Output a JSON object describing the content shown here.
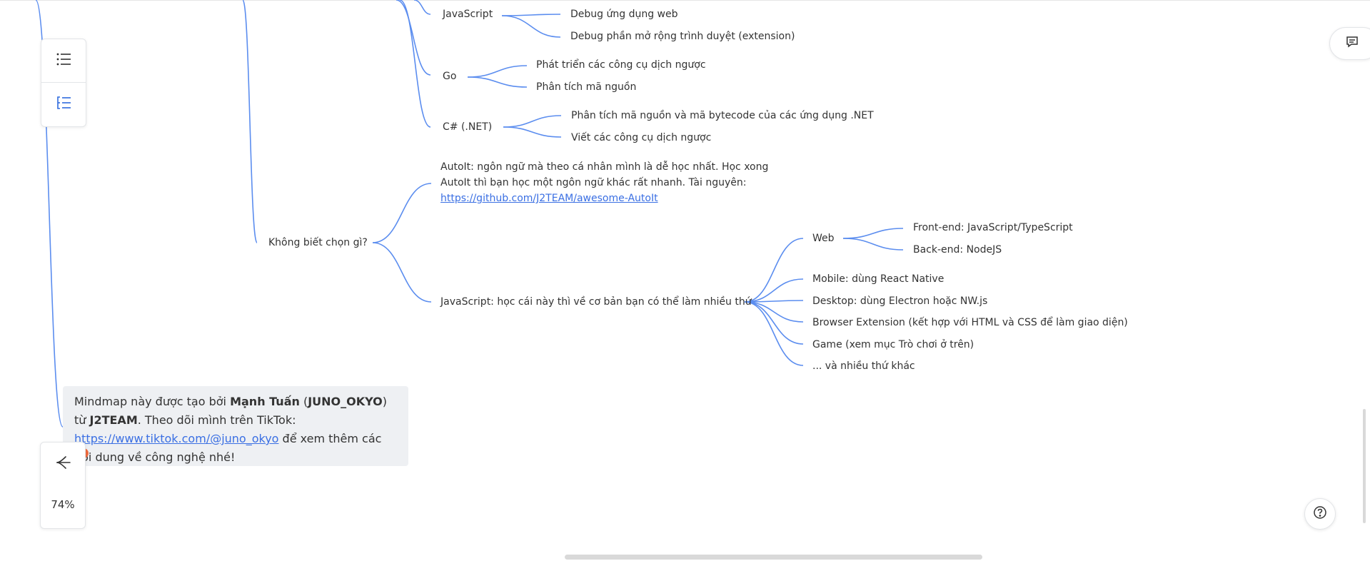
{
  "mindmap": {
    "lang_js": "JavaScript",
    "js_1": "Debug ứng dụng web",
    "js_2": "Debug phần mở rộng trình duyệt (extension)",
    "lang_go": "Go",
    "go_1": "Phát triển các công cụ dịch ngược",
    "go_2": "Phân tích mã nguồn",
    "lang_cs": "C# (.NET)",
    "cs_1": "Phân tích mã nguồn và mã bytecode của các ứng dụng .NET",
    "cs_2": "Viết các công cụ dịch ngược",
    "choose": "Không biết chọn gì?",
    "autoit_line1": "AutoIt: ngôn ngữ mà theo cá nhân mình là dễ học nhất. Học xong",
    "autoit_line2": "AutoIt thì bạn học một ngôn ngữ khác rất nhanh. Tài nguyên: ",
    "autoit_link": "https://github.com/J2TEAM/awesome-AutoIt",
    "js_choice": "JavaScript: học cái này thì về cơ bản bạn có thể làm nhiều thứ",
    "web": "Web",
    "frontend": "Front-end: JavaScript/TypeScript",
    "backend": "Back-end: NodeJS",
    "mobile": "Mobile: dùng React Native",
    "desktop": "Desktop: dùng Electron hoặc NW.js",
    "browser_ext": "Browser Extension (kết hợp với HTML và CSS để làm giao diện)",
    "game": "Game (xem mục Trò chơi ở trên)",
    "more": "... và nhiều thứ khác"
  },
  "note": {
    "p1": "Mindmap này được tạo bởi ",
    "author": "Mạnh Tuấn",
    "p2": " (",
    "nick": "JUNO_OKYO",
    "p3": ") từ ",
    "team": "J2TEAM",
    "p4": ". Theo dõi mình trên TikTok: ",
    "tiktok_link": "https://www.tiktok.com/@juno_okyo",
    "p5": " để xem thêm các nội dung về công nghệ nhé!"
  },
  "toolbar": {
    "outline_icon": "list-icon",
    "structure_icon": "outline-tree-icon",
    "layout_icon": "mindmap-layout-icon",
    "zoom": "74%"
  },
  "right_controls": {
    "comment_icon": "comment-icon",
    "help_icon": "help-icon"
  },
  "colors": {
    "edge": "#5b8def",
    "link": "#3a6fe3",
    "note_bg": "#eef0f3",
    "dot": "#ef6a3d"
  }
}
